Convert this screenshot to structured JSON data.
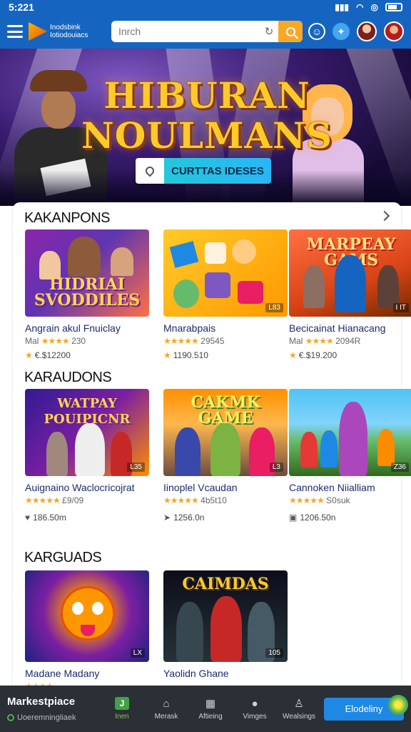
{
  "status_bar": {
    "time": "5:221"
  },
  "header": {
    "brand_line1": "Inodsbink",
    "brand_line2": "Iotiodouiacs",
    "search_placeholder": "Inrch",
    "icons": [
      "menu-icon",
      "refresh-icon",
      "search-icon",
      "user-circle-icon",
      "notification-icon",
      "avatar",
      "avatar"
    ]
  },
  "hero": {
    "title_line1": "HIBURAN",
    "title_line2": "NOULMANS",
    "cta_label": "CURTTAS IDESES"
  },
  "sections": [
    {
      "title": "KAKANPONS",
      "items": [
        {
          "thumb_text": "HIDRIAI SVODDILES",
          "badge": "",
          "name": "Angrain akul Fnuiclay",
          "meta_prefix": "Mal",
          "stars": "★★★★",
          "meta_count": "230",
          "price": "€.$12200"
        },
        {
          "thumb_text": "",
          "badge": "L83",
          "name": "Mnarabpais",
          "meta_prefix": "",
          "stars": "★★★★★",
          "meta_count": "29545",
          "price": "1190.510"
        },
        {
          "thumb_text": "MARPEAY GAMS",
          "badge": "I IT",
          "name": "Becicainat Hianacang",
          "meta_prefix": "Mal",
          "stars": "★★★★",
          "meta_count": "2094R",
          "price": "€.$19.200"
        }
      ]
    },
    {
      "title": "KARAUDONS",
      "items": [
        {
          "thumb_text": "WATPAY POUIPICNR",
          "badge": "L35",
          "name": "Auignaino Waclocricojrat",
          "meta_prefix": "",
          "stars": "★★★★★",
          "meta_count": "£9/09",
          "price": "186.50m"
        },
        {
          "thumb_text": "CAKMK GAME",
          "badge": "L3",
          "name": "Iinoplel Vcaudan",
          "meta_prefix": "",
          "stars": "★★★★★",
          "meta_count": "4b5t10",
          "price": "1256.0n"
        },
        {
          "thumb_text": "",
          "badge": "Z36",
          "name": "Cannoken Niialliam",
          "meta_prefix": "",
          "stars": "★★★★★",
          "meta_count": "S0suk",
          "price": "1206.50n"
        }
      ]
    },
    {
      "title": "KARGUADS",
      "items": [
        {
          "thumb_text": "",
          "badge": "LX",
          "name": "Madane Madany",
          "meta_prefix": "",
          "stars": "★★★★",
          "meta_count": "",
          "price": ""
        },
        {
          "thumb_text": "CAIMDAS",
          "badge": "105",
          "name": "Yaolidn Ghane",
          "meta_prefix": "",
          "stars": "",
          "meta_count": "",
          "price": ""
        }
      ]
    }
  ],
  "bottom_nav": {
    "market_title": "Markestpiace",
    "market_sub": "Uoeremningliaek",
    "items": [
      {
        "icon_label": "J",
        "label": "Inen",
        "active": true
      },
      {
        "icon_label": "",
        "label": "Merask",
        "active": false
      },
      {
        "icon_label": "",
        "label": "Aftieing",
        "active": false
      },
      {
        "icon_label": "",
        "label": "Vimges",
        "active": false
      },
      {
        "icon_label": "",
        "label": "Wealsings",
        "active": false
      }
    ],
    "cta_label": "Elodeliny"
  },
  "colors": {
    "brand_blue": "#1565c0",
    "accent_orange": "#f9a825",
    "nav_bg": "#2b2f36",
    "cta_blue": "#1e88e5",
    "star": "#f5a623"
  }
}
